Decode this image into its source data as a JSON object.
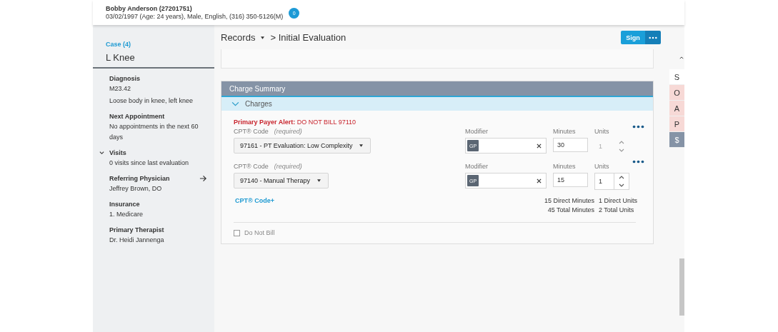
{
  "patient": {
    "name": "Bobby Anderson (27201751)",
    "details": "03/02/1997 (Age: 24 years), Male, English, (316) 350-5126(M)",
    "badge": "0"
  },
  "sidebar": {
    "case_link": "Case (4)",
    "case_name": "L Knee",
    "sections": [
      {
        "title": "Diagnosis",
        "lines": [
          "M23.42",
          "Loose body in knee, left knee"
        ],
        "expander": false,
        "arrow": false
      },
      {
        "title": "Next Appointment",
        "lines": [
          "No appointments in the next 60 days"
        ],
        "expander": false,
        "arrow": false
      },
      {
        "title": "Visits",
        "lines": [
          "0 visits since last evaluation"
        ],
        "expander": true,
        "arrow": false
      },
      {
        "title": "Referring Physician",
        "lines": [
          "Jeffrey Brown, DO"
        ],
        "expander": false,
        "arrow": true
      },
      {
        "title": "Insurance",
        "lines": [
          "1. Medicare"
        ],
        "expander": false,
        "arrow": false
      },
      {
        "title": "Primary Therapist",
        "lines": [
          "Dr. Heidi Jannenga"
        ],
        "expander": false,
        "arrow": false
      }
    ]
  },
  "breadcrumb": {
    "root": "Records",
    "separator": ">",
    "current": "Initial Evaluation"
  },
  "sign_button": "Sign",
  "charge_summary": {
    "title": "Charge Summary",
    "section": "Charges",
    "expanded": true,
    "alert_label": "Primary Payer Alert:",
    "alert_text": "DO NOT BILL 97110",
    "rows": [
      {
        "code_label": "CPT® Code",
        "required": "(required)",
        "code": "97161 - PT Evaluation: Low Complexity",
        "modifier_label": "Modifier",
        "modifier": "GP",
        "minutes_label": "Minutes",
        "minutes": "30",
        "units_label": "Units",
        "units": "1",
        "units_disabled": true
      },
      {
        "code_label": "CPT® Code",
        "required": "(required)",
        "code": "97140 - Manual Therapy",
        "modifier_label": "Modifier",
        "modifier": "GP",
        "minutes_label": "Minutes",
        "minutes": "15",
        "units_label": "Units",
        "units": "1",
        "units_disabled": false
      }
    ],
    "add_code": "CPT® Code+",
    "totals": [
      [
        "15 Direct Minutes",
        "1 Direct Units"
      ],
      [
        "45 Total Minutes",
        "2 Total Units"
      ]
    ],
    "do_not_bill": {
      "label": "Do Not Bill",
      "checked": false
    }
  },
  "soap_tabs": [
    {
      "label": "S",
      "selected": false,
      "color": "#ffffff"
    },
    {
      "label": "O",
      "selected": false,
      "color": "#f7d9d6"
    },
    {
      "label": "A",
      "selected": false,
      "color": "#f7d9d6"
    },
    {
      "label": "P",
      "selected": false,
      "color": "#f7d9d6"
    },
    {
      "label": "$",
      "selected": true,
      "color": "#8593a6"
    }
  ]
}
